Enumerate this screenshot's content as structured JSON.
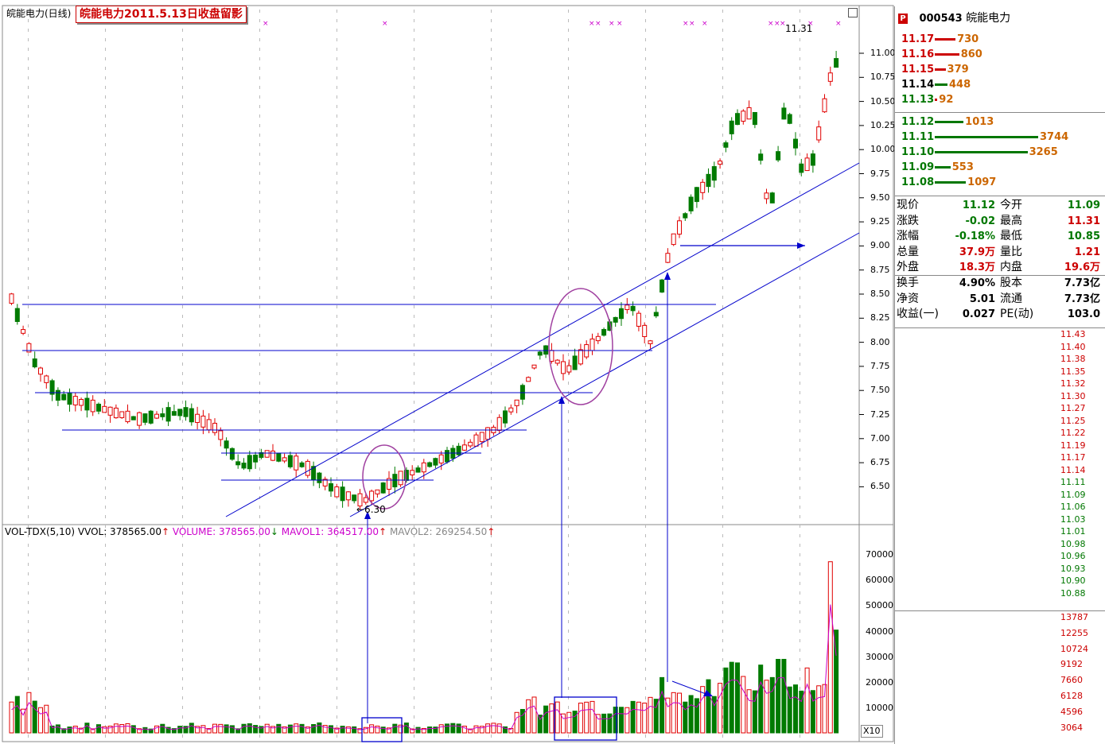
{
  "header": {
    "title": "皖能电力(日线)",
    "annotation": "皖能电力2011.5.13日收盘留影",
    "low_label": "←6.30",
    "high_label": "11.31"
  },
  "price_axis": [
    "11.00",
    "10.75",
    "10.50",
    "10.25",
    "10.00",
    "9.75",
    "9.50",
    "9.25",
    "9.00",
    "8.75",
    "8.50",
    "8.25",
    "8.00",
    "7.75",
    "7.50",
    "7.25",
    "7.00",
    "6.75",
    "6.50"
  ],
  "volume_legend": {
    "name": "VOL-TDX(5,10)",
    "vvol": "VVOL: 378565.00",
    "volume": "VOLUME: 378565.00",
    "mavol1": "MAVOL1: 364517.00",
    "mavol2": "MAVOL2: 269254.50"
  },
  "volume_axis": [
    "70000",
    "60000",
    "50000",
    "40000",
    "30000",
    "20000",
    "10000"
  ],
  "volume_unit": "X10",
  "quote": {
    "code": "000543",
    "name": "皖能电力",
    "asks": [
      {
        "price": "11.17",
        "vol": "730"
      },
      {
        "price": "11.16",
        "vol": "860"
      },
      {
        "price": "11.15",
        "vol": "379"
      },
      {
        "price": "11.14",
        "vol": "448"
      },
      {
        "price": "11.13",
        "vol": "92"
      }
    ],
    "bids": [
      {
        "price": "11.12",
        "vol": "1013"
      },
      {
        "price": "11.11",
        "vol": "3744"
      },
      {
        "price": "11.10",
        "vol": "3265"
      },
      {
        "price": "11.09",
        "vol": "553"
      },
      {
        "price": "11.08",
        "vol": "1097"
      }
    ],
    "rows": [
      {
        "l1": "现价",
        "v1": "11.12",
        "l2": "今开",
        "v2": "11.09"
      },
      {
        "l1": "涨跌",
        "v1": "-0.02",
        "l2": "最高",
        "v2": "11.31"
      },
      {
        "l1": "涨幅",
        "v1": "-0.18%",
        "l2": "最低",
        "v2": "10.85"
      },
      {
        "l1": "总量",
        "v1": "37.9万",
        "l2": "量比",
        "v2": "1.21"
      },
      {
        "l1": "外盘",
        "v1": "18.3万",
        "l2": "内盘",
        "v2": "19.6万"
      },
      {
        "l1": "换手",
        "v1": "4.90%",
        "l2": "股本",
        "v2": "7.73亿"
      },
      {
        "l1": "净资",
        "v1": "5.01",
        "l2": "流通",
        "v2": "7.73亿"
      },
      {
        "l1": "收益(一)",
        "v1": "0.027",
        "l2": "PE(动)",
        "v2": "103.0"
      }
    ]
  },
  "intraday_axis": [
    "11.43",
    "11.40",
    "11.38",
    "11.35",
    "11.32",
    "11.30",
    "11.27",
    "11.25",
    "11.22",
    "11.19",
    "11.17",
    "11.14",
    "11.11",
    "11.09",
    "11.06",
    "11.03",
    "11.01",
    "10.98",
    "10.96",
    "10.93",
    "10.90",
    "10.88"
  ],
  "intraday_vol_axis": [
    "13787",
    "12255",
    "10724",
    "9192",
    "7660",
    "6128",
    "4596",
    "3064"
  ],
  "colors": {
    "up": "#e00000",
    "down": "#007a00",
    "trend": "#0000cc",
    "ring": "#a040a0",
    "ma": "#cc00cc"
  }
}
